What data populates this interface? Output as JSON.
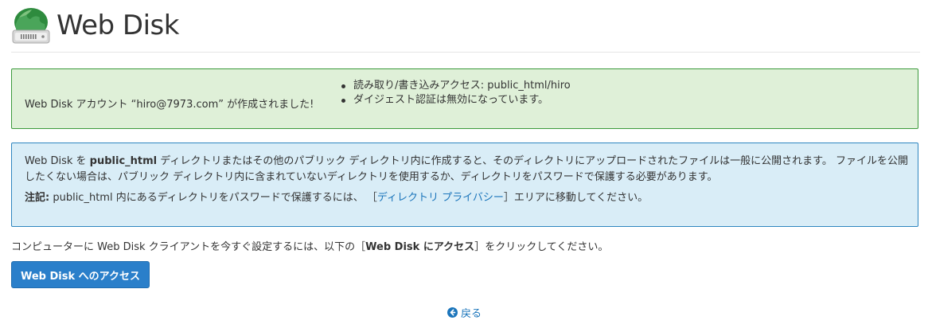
{
  "header": {
    "title": "Web Disk",
    "icon": "web-disk-icon"
  },
  "success_alert": {
    "message": "Web Disk アカウント “hiro@7973.com” が作成されました!",
    "items": [
      "読み取り/書き込みアクセス: public_html/hiro",
      "ダイジェスト認証は無効になっています。"
    ],
    "color": "#dff0d8"
  },
  "info_alert": {
    "p1_before": "Web Disk を ",
    "p1_bold": "public_html",
    "p1_after": " ディレクトリまたはその他のパブリック ディレクトリ内に作成すると、そのディレクトリにアップロードされたファイルは一般に公開されます。 ファイルを公開したくない場合は、パブリック ディレクトリ内に含まれていないディレクトリを使用するか、ディレクトリをパスワードで保護する必要があります。",
    "note_label": "注記:",
    "note_before": " public_html 内にあるディレクトリをパスワードで保護するには、 ［",
    "note_link": "ディレクトリ プライバシー",
    "note_after": "］エリアに移動してください。",
    "color": "#d9edf7"
  },
  "instruction": {
    "before": "コンピューターに Web Disk クライアントを今すぐ設定するには、以下の［",
    "bold": "Web Disk にアクセス",
    "after": "］をクリックしてください。"
  },
  "access_button": {
    "label": "Web Disk へのアクセス",
    "color": "#2a7fca"
  },
  "back_link": {
    "label": "戻る",
    "icon": "arrow-left-circle-icon"
  }
}
